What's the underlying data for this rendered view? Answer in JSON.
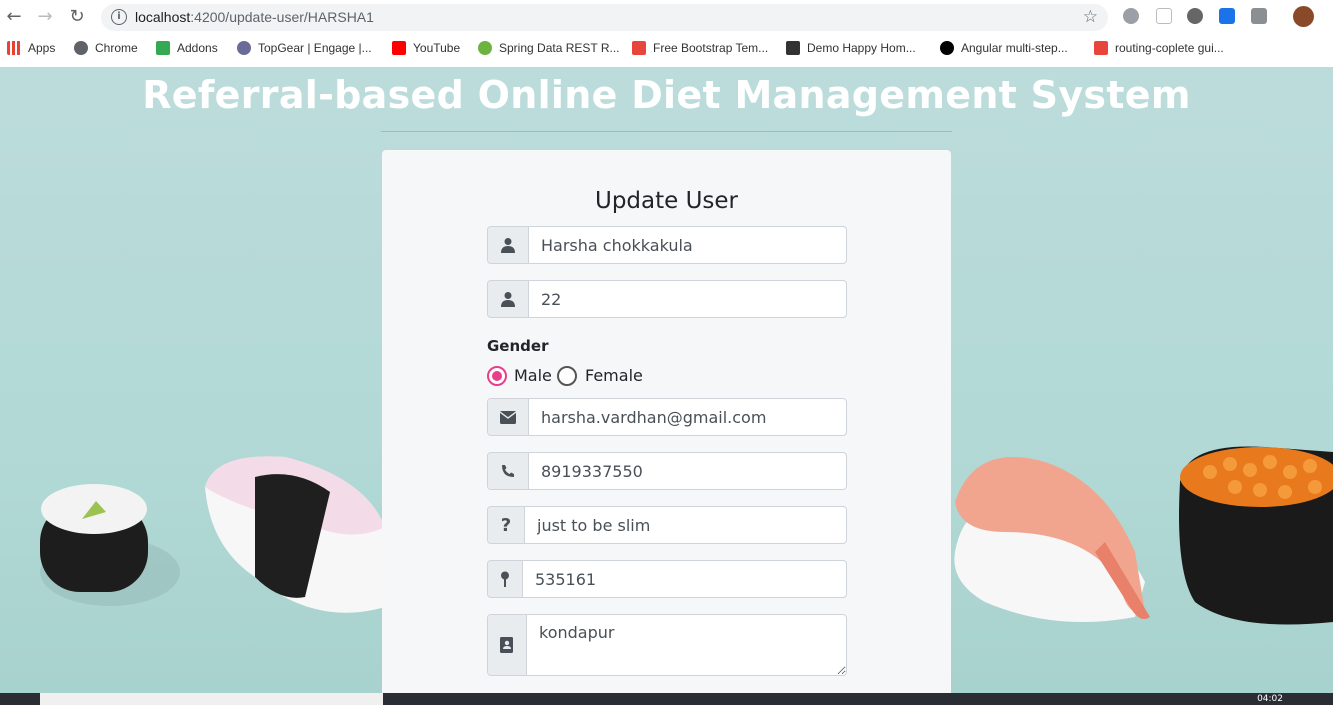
{
  "browser": {
    "url_host": "localhost",
    "url_rest": ":4200/update-user/HARSHA1",
    "bookmarks": [
      {
        "label": "Apps",
        "color": "#e94235"
      },
      {
        "label": "Chrome",
        "color": "#5f6368"
      },
      {
        "label": "Addons",
        "color": "#34a853"
      },
      {
        "label": "TopGear | Engage |...",
        "color": "#6b6b9a"
      },
      {
        "label": "YouTube",
        "color": "#ff0000"
      },
      {
        "label": "Spring Data REST R...",
        "color": "#6db33f"
      },
      {
        "label": "Free Bootstrap Tem...",
        "color": "#e8453c"
      },
      {
        "label": "Demo Happy Hom...",
        "color": "#333333"
      },
      {
        "label": "Angular multi-step...",
        "color": "#000000"
      },
      {
        "label": "routing-coplete gui...",
        "color": "#e8453c"
      }
    ]
  },
  "page": {
    "headline": "Referral-based Online Diet Management System",
    "form_title": "Update User",
    "fields": {
      "name": {
        "value": "Harsha chokkakula",
        "icon": "user-icon"
      },
      "age": {
        "value": "22",
        "icon": "user-icon"
      },
      "gender_label": "Gender",
      "gender_options": [
        {
          "label": "Male",
          "selected": true
        },
        {
          "label": "Female",
          "selected": false
        }
      ],
      "email": {
        "value": "harsha.vardhan@gmail.com",
        "icon": "envelope-icon"
      },
      "phone": {
        "value": "8919337550",
        "icon": "phone-icon"
      },
      "reason": {
        "value": "just to be slim",
        "icon": "question-icon"
      },
      "pincode": {
        "value": "535161",
        "icon": "map-pin-icon"
      },
      "address": {
        "value": "kondapur",
        "icon": "address-book-icon"
      }
    },
    "accent_color": "#e83e8c"
  },
  "taskbar": {
    "time": "04:02"
  }
}
